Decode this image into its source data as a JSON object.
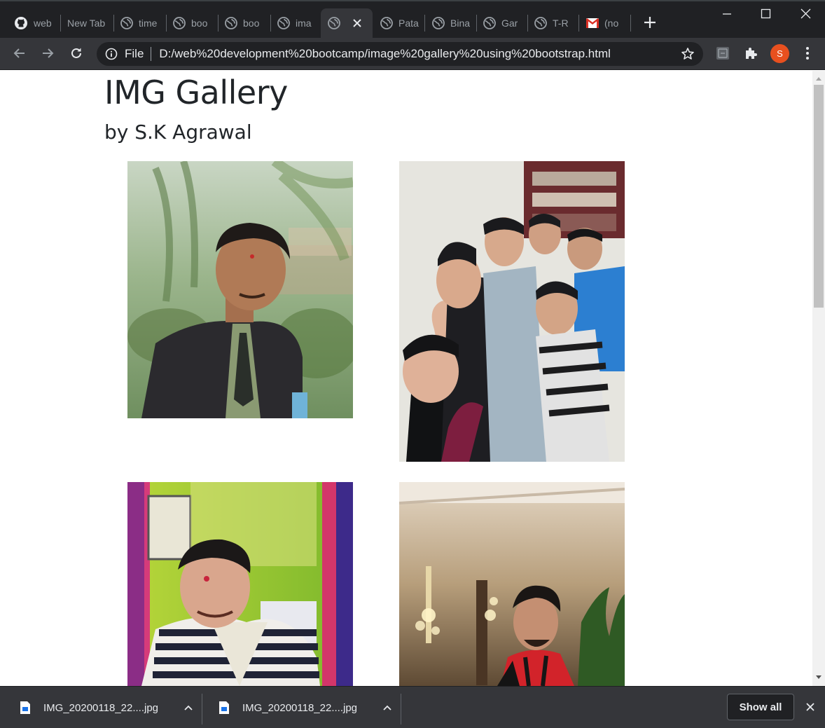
{
  "browser": {
    "tabs": [
      {
        "icon": "github-icon",
        "title": "web"
      },
      {
        "icon": "none",
        "title": "New Tab"
      },
      {
        "icon": "globe-icon",
        "title": "time"
      },
      {
        "icon": "globe-icon",
        "title": "boo"
      },
      {
        "icon": "globe-icon",
        "title": "boo"
      },
      {
        "icon": "globe-icon",
        "title": "ima"
      },
      {
        "icon": "globe-icon",
        "title": "",
        "active": true
      },
      {
        "icon": "globe-icon",
        "title": "Pata"
      },
      {
        "icon": "globe-icon",
        "title": "Bina"
      },
      {
        "icon": "globe-icon",
        "title": "Gar"
      },
      {
        "icon": "globe-icon",
        "title": "T-R"
      },
      {
        "icon": "gmail-icon",
        "title": "(no"
      }
    ],
    "address_bar": {
      "scheme_label": "File",
      "url": "D:/web%20development%20bootcamp/image%20gallery%20using%20bootstrap.html"
    },
    "profile_initial": "S"
  },
  "page": {
    "title": "IMG Gallery",
    "subtitle": "by S.K Agrawal",
    "photos": [
      {
        "description": "portrait-suit-outdoor"
      },
      {
        "description": "group-selfie-friends"
      },
      {
        "description": "portrait-striped-sweater"
      },
      {
        "description": "portrait-red-shirt-lobby"
      }
    ]
  },
  "downloads": {
    "items": [
      {
        "filename": "IMG_20200118_22....jpg"
      },
      {
        "filename": "IMG_20200118_22....jpg"
      }
    ],
    "show_all_label": "Show all"
  },
  "colors": {
    "chrome_dark": "#202124",
    "toolbar": "#35363a",
    "text_primary": "#212529",
    "avatar": "#e8501f"
  }
}
